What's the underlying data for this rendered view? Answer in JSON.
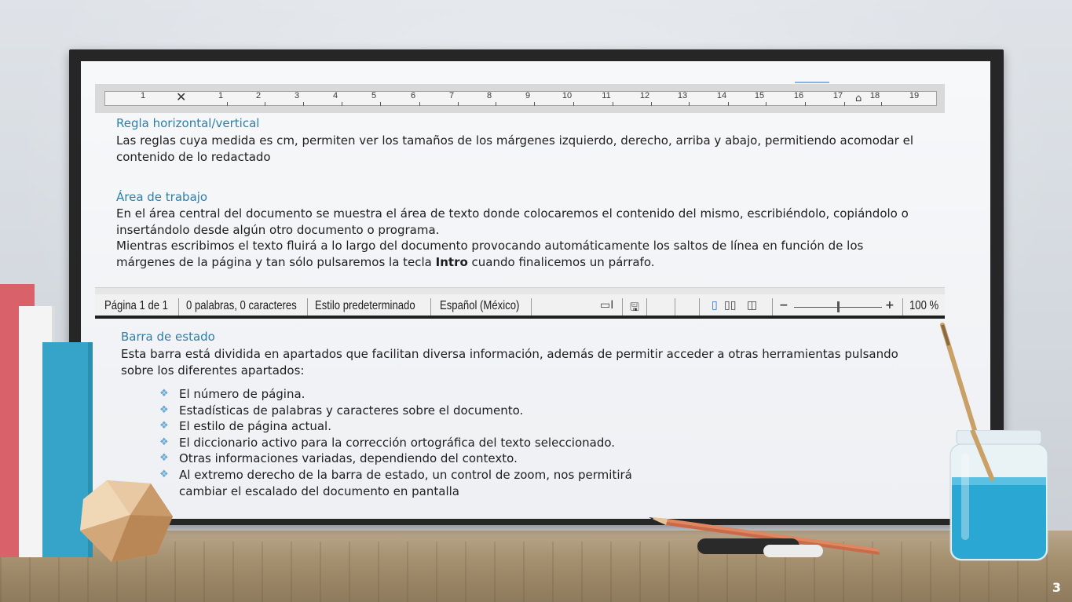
{
  "ruler": {
    "numbers": [
      "1",
      "1",
      "2",
      "3",
      "4",
      "5",
      "6",
      "7",
      "8",
      "9",
      "10",
      "11",
      "12",
      "13",
      "14",
      "15",
      "16",
      "17",
      "18",
      "19"
    ]
  },
  "sections": {
    "ruler_title": "Regla horizontal/vertical",
    "ruler_text": "Las reglas cuya medida es cm, permiten ver los tamaños de los márgenes izquierdo, derecho, arriba y abajo, permitiendo acomodar el contenido de lo redactado",
    "work_title": "Área de trabajo",
    "work_text1": "En el área central del documento se muestra el área de texto donde colocaremos el contenido del mismo, escribiéndolo, copiándolo o insertándolo desde algún otro documento o programa.",
    "work_text2_a": "Mientras escribimos el texto fluirá a lo largo del documento provocando automáticamente los saltos de línea en función de los márgenes de la página y tan sólo pulsaremos la tecla ",
    "work_text2_bold": "Intro",
    "work_text2_b": "  cuando finalicemos un párrafo.",
    "status_title": "Barra de estado",
    "status_text": "Esta barra está dividida en apartados que facilitan diversa información, además de permitir acceder a otras herramientas pulsando sobre los diferentes apartados:"
  },
  "status_bar": {
    "page": "Página 1 de 1",
    "words": "0 palabras, 0 caracteres",
    "style": "Estilo predeterminado",
    "language": "Español (México)",
    "zoom": "100 %",
    "zoom_level": 0.5
  },
  "list": [
    "El número de página.",
    "Estadísticas de palabras y caracteres sobre el documento.",
    "El estilo de página actual.",
    "El diccionario activo para la corrección ortográfica del texto seleccionado.",
    "Otras informaciones variadas, dependiendo del contexto.",
    "Al extremo derecho de la barra de estado, un control de zoom, nos permitirá cambiar el escalado del documento en pantalla"
  ],
  "page_number": "3",
  "colors": {
    "heading": "#2f7ea6",
    "bullet": "#6aa8d4",
    "board_frame": "#262626"
  }
}
